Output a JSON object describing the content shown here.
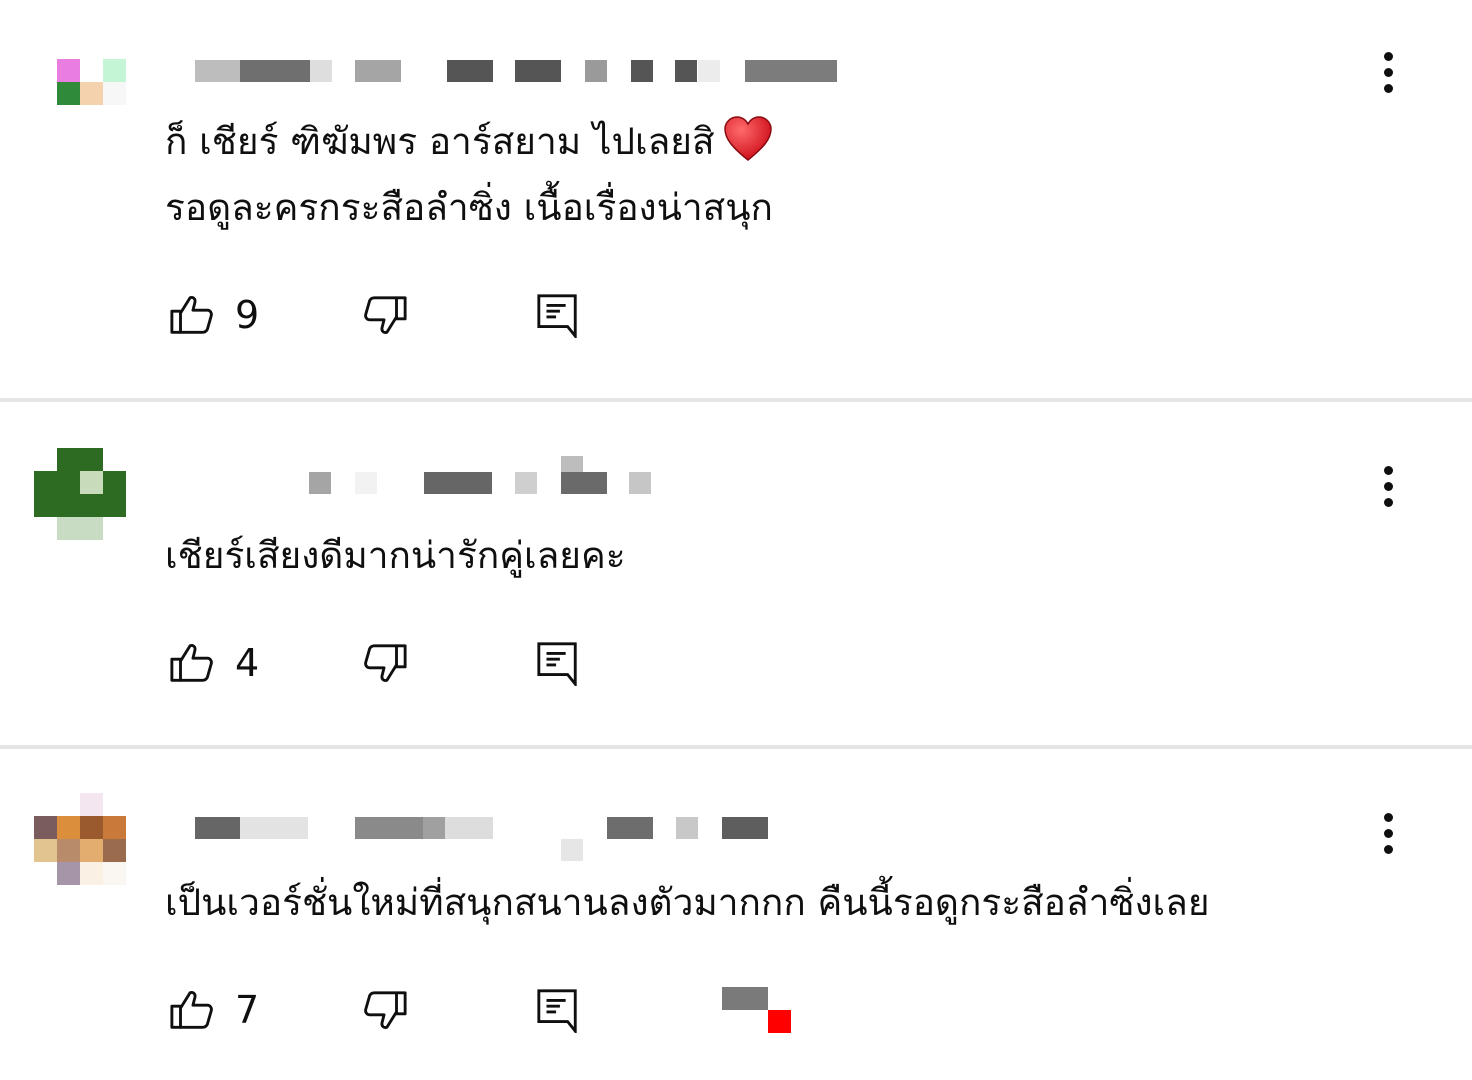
{
  "comments": [
    {
      "text_lines": [
        "ก็ เชียร์ ฑิฆัมพร อาร์สยาม ไปเลยสิ",
        "รอดูละครกระสือลำซิ่ง เนื้อเรื่องน่าสนุก"
      ],
      "has_heart_emoji": true,
      "likes": "9",
      "author_censored": true
    },
    {
      "text_lines": [
        "เชียร์เสียงดีมากน่ารักคู่เลยคะ"
      ],
      "has_heart_emoji": false,
      "likes": "4",
      "author_censored": true
    },
    {
      "text_lines": [
        "เป็นเวอร์ชั่นใหม่ที่สนุกสนานลงตัวมากกก คืนนี้รอดูกระสือลำซิ่งเลย"
      ],
      "has_heart_emoji": false,
      "likes": "7",
      "author_censored": true
    }
  ],
  "icons": {
    "like": "thumbs-up-icon",
    "dislike": "thumbs-down-icon",
    "reply": "reply-comment-icon",
    "more": "more-vertical-icon",
    "heart": "red-heart-emoji"
  },
  "colors": {
    "text": "#0f0f0f",
    "divider": "#e5e5e5",
    "heart": "#e0242f"
  }
}
